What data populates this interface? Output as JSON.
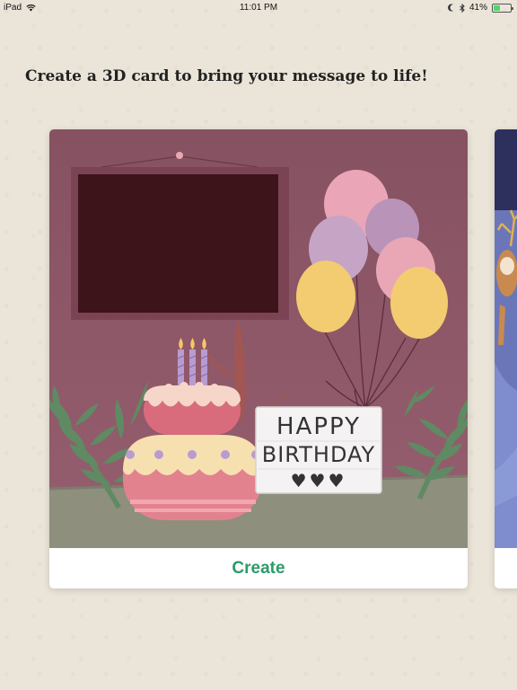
{
  "status_bar": {
    "device": "iPad",
    "wifi_icon": "wifi-icon",
    "time": "11:01 PM",
    "moon_icon": "do-not-disturb-icon",
    "bluetooth_icon": "bluetooth-icon",
    "battery_percent": "41%",
    "battery_level": 0.41
  },
  "headline": "Create a 3D card to bring your message to life!",
  "cards": [
    {
      "theme": "birthday",
      "sign_line1": "HAPPY",
      "sign_line2": "BIRTHDAY",
      "sign_hearts": "♥♥♥",
      "action_label": "Create",
      "colors": {
        "wall": "#8e5868",
        "floor": "#8f8f7e",
        "action": "#2e9a6a"
      }
    },
    {
      "theme": "reindeer"
    }
  ]
}
